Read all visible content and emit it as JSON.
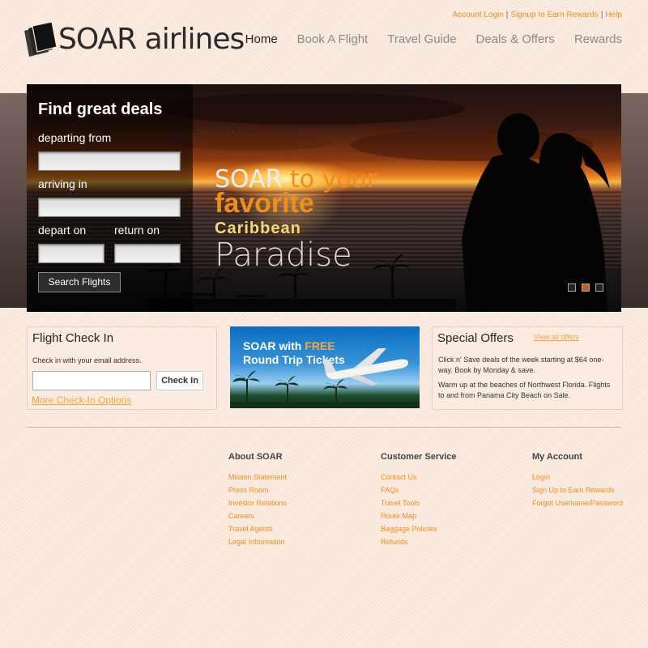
{
  "top_links": {
    "account_login": "Account Login",
    "sep": "|",
    "signup": "Signup to Earn Rewards",
    "help": "Help"
  },
  "logo": {
    "text": "SOAR airlines"
  },
  "nav": {
    "items": [
      "Home",
      "Book A Flight",
      "Travel Guide",
      "Deals & Offers",
      "Rewards"
    ],
    "active": "Home"
  },
  "hero": {
    "panel_title": "Find great deals",
    "departing_label": "departing from",
    "arriving_label": "arriving in",
    "depart_label": "depart on",
    "return_label": "return on",
    "departing_value": "",
    "arriving_value": "",
    "depart_value": "",
    "return_value": "",
    "search_button": "Search Flights",
    "tagline_soar": "SOAR",
    "tagline_to_your": " to your",
    "tagline_favorite": "favorite",
    "tagline_caribbean": "Caribbean",
    "tagline_paradise": "Paradise",
    "slides": 3,
    "active_slide": 2
  },
  "checkin": {
    "title": "Flight Check In",
    "desc": "Check in with your email address.",
    "email_value": "",
    "button": "Check In",
    "more": "More Check-In Options"
  },
  "promo": {
    "line1_a": "SOAR with ",
    "line1_b": "FREE",
    "line2": "Round Trip Tickets"
  },
  "offers": {
    "title": "Special Offers",
    "view_all": "View all offers",
    "p1": "Click n' Save deals of the week starting at $64 one-way. Book by Monday & save.",
    "p2": "Warm up at the beaches of Northwest Florida. Flights to and from Panama City Beach on Sale."
  },
  "footer": {
    "about": {
      "title": "About SOAR",
      "links": [
        "Misson Statement",
        "Press Room",
        "Investor Relations",
        "Careers",
        "Travel Agents",
        "Legal Information"
      ]
    },
    "service": {
      "title": "Customer Service",
      "links": [
        "Contact Us",
        "FAQs",
        "Travel Tools",
        "Route Map",
        "Baggage Policies",
        "Refunds"
      ]
    },
    "account": {
      "title": "My Account",
      "links": [
        "Login",
        "Sign Up to Earn Rewards",
        "Forgot Username/Password"
      ]
    }
  },
  "colors": {
    "accent": "#f08c1c",
    "background": "#fbe9dc",
    "dark": "#2b2b2b"
  }
}
